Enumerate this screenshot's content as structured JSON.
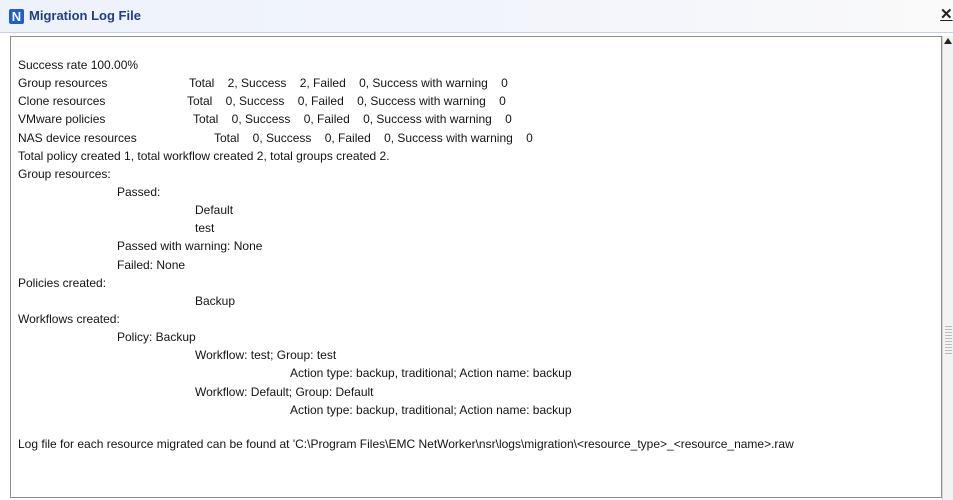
{
  "window": {
    "title": "Migration Log File",
    "app_icon_letter": "N",
    "close_symbol": "✕"
  },
  "log": {
    "success_rate": "Success rate 100.00%",
    "group_row": [
      "Group resources",
      "Total    2, Success    2, Failed    0, Success with warning    0"
    ],
    "clone_row": [
      "Clone resources",
      "Total    0, Success    0, Failed    0, Success with warning    0"
    ],
    "vmware_row": [
      "VMware policies",
      "Total    0, Success    0, Failed    0, Success with warning    0"
    ],
    "nas_row": [
      "NAS device resources",
      "Total    0, Success    0, Failed    0, Success with warning    0"
    ],
    "summary": "Total policy created 1, total workflow created 2, total groups created 2.",
    "group_header": "Group resources:",
    "passed": "Passed:",
    "passed_items": [
      "Default",
      "test"
    ],
    "passed_warning": "Passed with warning: None",
    "failed": "Failed: None",
    "policies_header": "Policies created:",
    "policy_items": [
      "Backup"
    ],
    "workflows_header": "Workflows created:",
    "policy_label": "Policy: Backup",
    "workflow_1": "Workflow: test; Group: test",
    "action_1": "Action type: backup, traditional; Action name: backup",
    "workflow_2": "Workflow: Default; Group: Default",
    "action_2": "Action type: backup, traditional; Action name: backup",
    "footer": "Log file for each resource migrated can be found at 'C:\\Program Files\\EMC NetWorker\\nsr\\logs\\migration\\<resource_type>_<resource_name>.raw"
  }
}
